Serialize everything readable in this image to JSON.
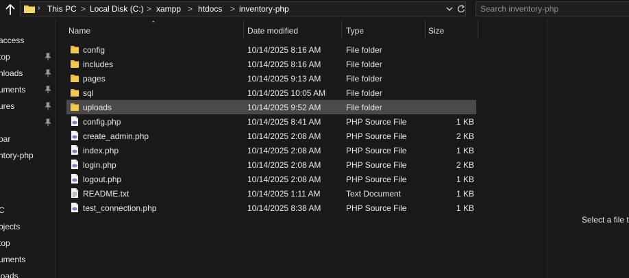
{
  "address_bar": {
    "breadcrumbs": [
      "This PC",
      "Local Disk (C:)",
      "xampp",
      "htdocs",
      "inventory-php"
    ],
    "separator": ">",
    "search_placeholder": "Search inventory-php"
  },
  "nav_pane": {
    "items": [
      {
        "label": "access",
        "pinned": false
      },
      {
        "label": "top",
        "pinned": true
      },
      {
        "label": "nloads",
        "pinned": true
      },
      {
        "label": "uments",
        "pinned": true
      },
      {
        "label": "ures",
        "pinned": true
      },
      {
        "label": "",
        "pinned": true
      },
      {
        "label": "bar",
        "pinned": false
      },
      {
        "label": "ntory-php",
        "pinned": false
      },
      {
        "label": "C",
        "pinned": false
      },
      {
        "label": "bjects",
        "pinned": false
      },
      {
        "label": "top",
        "pinned": false
      },
      {
        "label": "uments",
        "pinned": false
      },
      {
        "label": "loads",
        "pinned": false
      }
    ]
  },
  "columns": {
    "name": "Name",
    "date_modified": "Date modified",
    "type": "Type",
    "size": "Size"
  },
  "files": [
    {
      "name": "config",
      "date": "10/14/2025 8:16 AM",
      "type": "File folder",
      "size": "",
      "icon": "folder-icon",
      "selected": false
    },
    {
      "name": "includes",
      "date": "10/14/2025 8:16 AM",
      "type": "File folder",
      "size": "",
      "icon": "folder-icon",
      "selected": false
    },
    {
      "name": "pages",
      "date": "10/14/2025 9:13 AM",
      "type": "File folder",
      "size": "",
      "icon": "folder-icon",
      "selected": false
    },
    {
      "name": "sql",
      "date": "10/14/2025 10:05 AM",
      "type": "File folder",
      "size": "",
      "icon": "folder-icon",
      "selected": false
    },
    {
      "name": "uploads",
      "date": "10/14/2025 9:52 AM",
      "type": "File folder",
      "size": "",
      "icon": "folder-icon",
      "selected": true
    },
    {
      "name": "config.php",
      "date": "10/14/2025 8:41 AM",
      "type": "PHP Source File",
      "size": "1 KB",
      "icon": "php-file-icon",
      "selected": false
    },
    {
      "name": "create_admin.php",
      "date": "10/14/2025 2:08 AM",
      "type": "PHP Source File",
      "size": "2 KB",
      "icon": "php-file-icon",
      "selected": false
    },
    {
      "name": "index.php",
      "date": "10/14/2025 2:08 AM",
      "type": "PHP Source File",
      "size": "1 KB",
      "icon": "php-file-icon",
      "selected": false
    },
    {
      "name": "login.php",
      "date": "10/14/2025 2:08 AM",
      "type": "PHP Source File",
      "size": "2 KB",
      "icon": "php-file-icon",
      "selected": false
    },
    {
      "name": "logout.php",
      "date": "10/14/2025 2:08 AM",
      "type": "PHP Source File",
      "size": "1 KB",
      "icon": "php-file-icon",
      "selected": false
    },
    {
      "name": "README.txt",
      "date": "10/14/2025 1:11 AM",
      "type": "Text Document",
      "size": "1 KB",
      "icon": "text-file-icon",
      "selected": false
    },
    {
      "name": "test_connection.php",
      "date": "10/14/2025 8:38 AM",
      "type": "PHP Source File",
      "size": "1 KB",
      "icon": "php-file-icon",
      "selected": false
    }
  ],
  "preview_pane": {
    "message": "Select a file to"
  },
  "colors": {
    "background": "#191919",
    "selected_row": "#4a4a4a",
    "folder_yellow": "#f3c94d",
    "php_purple": "#7b7fc4"
  }
}
